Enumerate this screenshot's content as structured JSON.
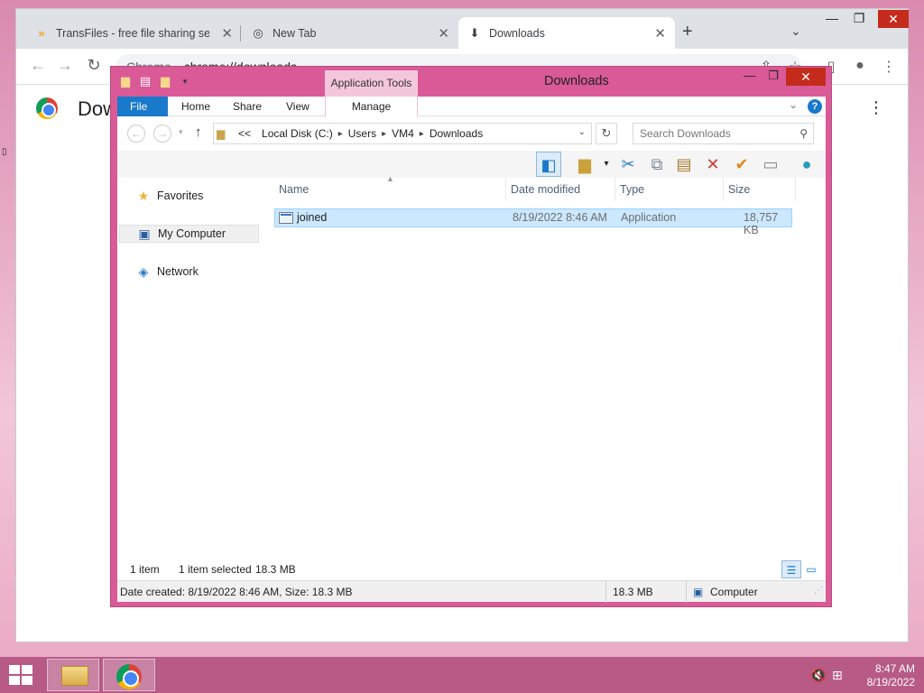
{
  "chrome": {
    "tabs": [
      {
        "label": "TransFiles - free file sharing servic",
        "close": "✕"
      },
      {
        "label": "New Tab",
        "close": "✕"
      },
      {
        "label": "Downloads",
        "close": "✕"
      }
    ],
    "new_tab": "+",
    "url_chip": "Chrome",
    "url": "chrome://downloads",
    "page_title": "Dow"
  },
  "explorer": {
    "title": "Downloads",
    "context_tab": "Application Tools",
    "ribbon_tabs": {
      "file": "File",
      "home": "Home",
      "share": "Share",
      "view": "View",
      "manage": "Manage"
    },
    "address": {
      "overflow": "<<",
      "crumbs": [
        "Local Disk (C:)",
        "Users",
        "VM4",
        "Downloads"
      ]
    },
    "search_placeholder": "Search Downloads",
    "nav": {
      "favorites": "Favorites",
      "my_computer": "My Computer",
      "network": "Network"
    },
    "columns": {
      "name": "Name",
      "date": "Date modified",
      "type": "Type",
      "size": "Size"
    },
    "files": [
      {
        "name": "joined",
        "date": "8/19/2022 8:46 AM",
        "type": "Application",
        "size": "18,757 KB"
      }
    ],
    "status": {
      "count": "1 item",
      "selected": "1 item selected",
      "selected_size": "18.3 MB"
    },
    "details": {
      "info": "Date created: 8/19/2022 8:46 AM, Size: 18.3 MB",
      "size": "18.3 MB",
      "location": "Computer"
    }
  },
  "taskbar": {
    "time": "8:47 AM",
    "date": "8/19/2022"
  },
  "colors": {
    "explorer_frame": "#d95a97",
    "file_tab": "#1979ca",
    "selection": "#cce8ff"
  }
}
